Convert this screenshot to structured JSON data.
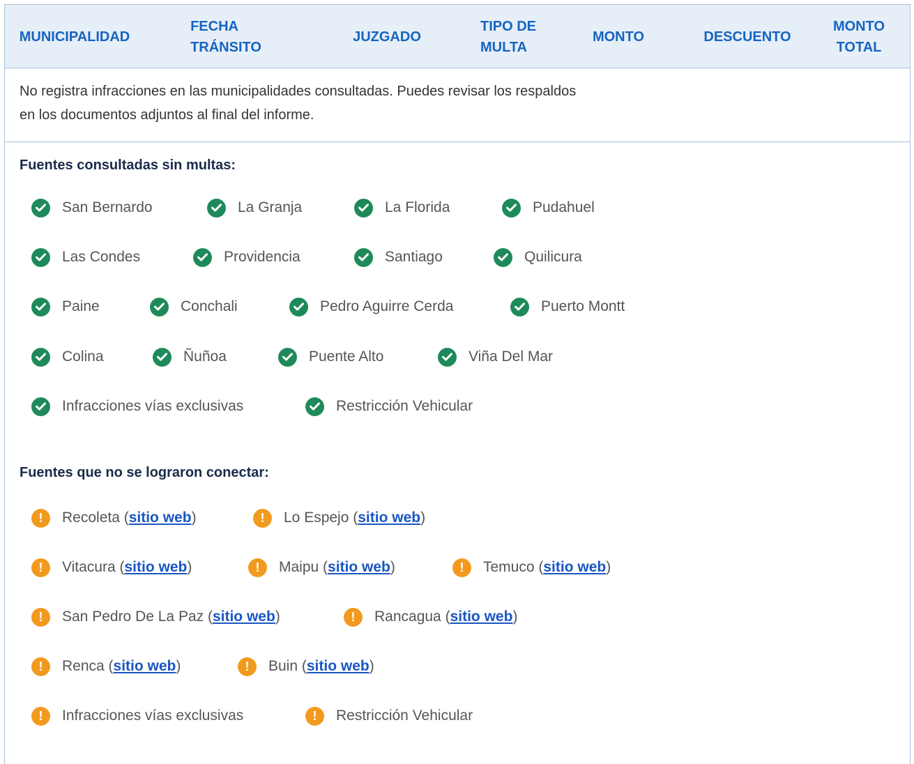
{
  "table_header": {
    "col1": [
      "MUNICIPALIDAD"
    ],
    "col2": [
      "FECHA",
      "TRÁNSITO"
    ],
    "col3": [
      "JUZGADO"
    ],
    "col4": [
      "TIPO DE",
      "MULTA"
    ],
    "col5": [
      "MONTO"
    ],
    "col6": [
      "DESCUENTO"
    ],
    "col7": [
      "MONTO",
      "TOTAL"
    ]
  },
  "notice": {
    "line1": "No registra infracciones en las municipalidades consultadas. Puedes revisar los respaldos",
    "line2": "en los documentos adjuntos al final del informe."
  },
  "ok_section": {
    "title": "Fuentes consultadas sin multas:",
    "rows": [
      [
        "San Bernardo",
        "La Granja",
        "La Florida",
        "Pudahuel"
      ],
      [
        "Las Condes",
        "Providencia",
        "Santiago",
        "Quilicura"
      ],
      [
        "Paine",
        "Conchali",
        "Pedro Aguirre Cerda",
        "Puerto Montt"
      ],
      [
        "Colina",
        "Ñuñoa",
        "Puente Alto",
        "Viña Del Mar"
      ],
      [
        "Infracciones vías exclusivas",
        "Restricción Vehicular"
      ]
    ]
  },
  "fail_section": {
    "title": "Fuentes que no se lograron conectar:",
    "link_label": "sitio web",
    "rows": [
      [
        "Recoleta",
        "Lo Espejo"
      ],
      [
        "Vitacura",
        "Maipu",
        "Temuco"
      ],
      [
        "San Pedro De La Paz",
        "Rancagua"
      ],
      [
        "Renca",
        "Buin"
      ]
    ],
    "last_row": [
      "Infracciones vías exclusivas",
      "Restricción Vehicular"
    ]
  },
  "colors": {
    "header_text": "#1565c0",
    "ok_icon": "#1e8a5a",
    "warn_icon": "#f29a1f",
    "link": "#1a56c4"
  },
  "icons": {
    "ok": "check-circle-icon",
    "warn": "exclamation-circle-icon"
  }
}
